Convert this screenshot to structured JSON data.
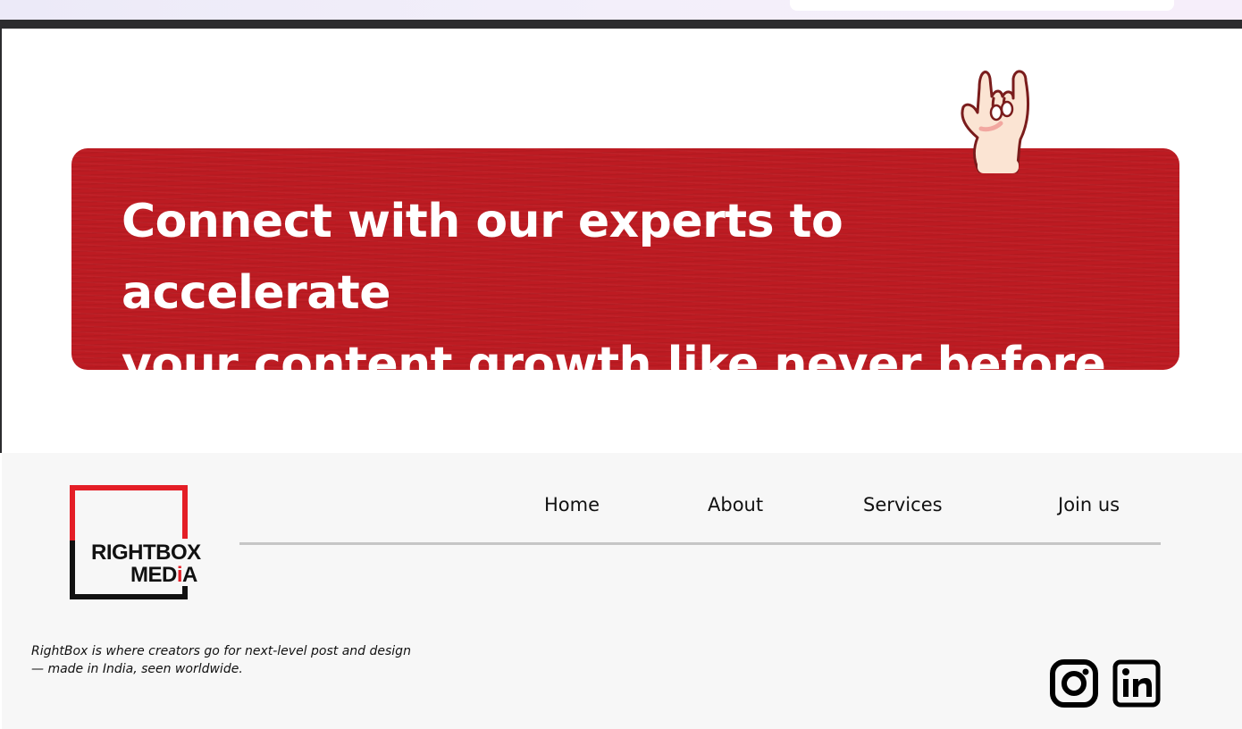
{
  "banner": {
    "line1": "Connect with our experts to accelerate",
    "line2": "your content growth like never before"
  },
  "logo": {
    "line1": "RIGHTBOX",
    "line2_prefix": "MED",
    "line2_i": "i",
    "line2_suffix": "A"
  },
  "nav": {
    "items": [
      {
        "label": "Home"
      },
      {
        "label": "About"
      },
      {
        "label": "Services"
      },
      {
        "label": "Join us"
      }
    ]
  },
  "footer": {
    "tagline_line1": "RightBox is where creators go for next-level post and design",
    "tagline_line2": "— made in India, seen worldwide."
  },
  "social": {
    "icons": [
      "instagram-icon",
      "linkedin-icon"
    ]
  },
  "colors": {
    "banner_red": "#bd1b22",
    "logo_red": "#e41e26",
    "footer_bg": "#f7f7f7"
  }
}
